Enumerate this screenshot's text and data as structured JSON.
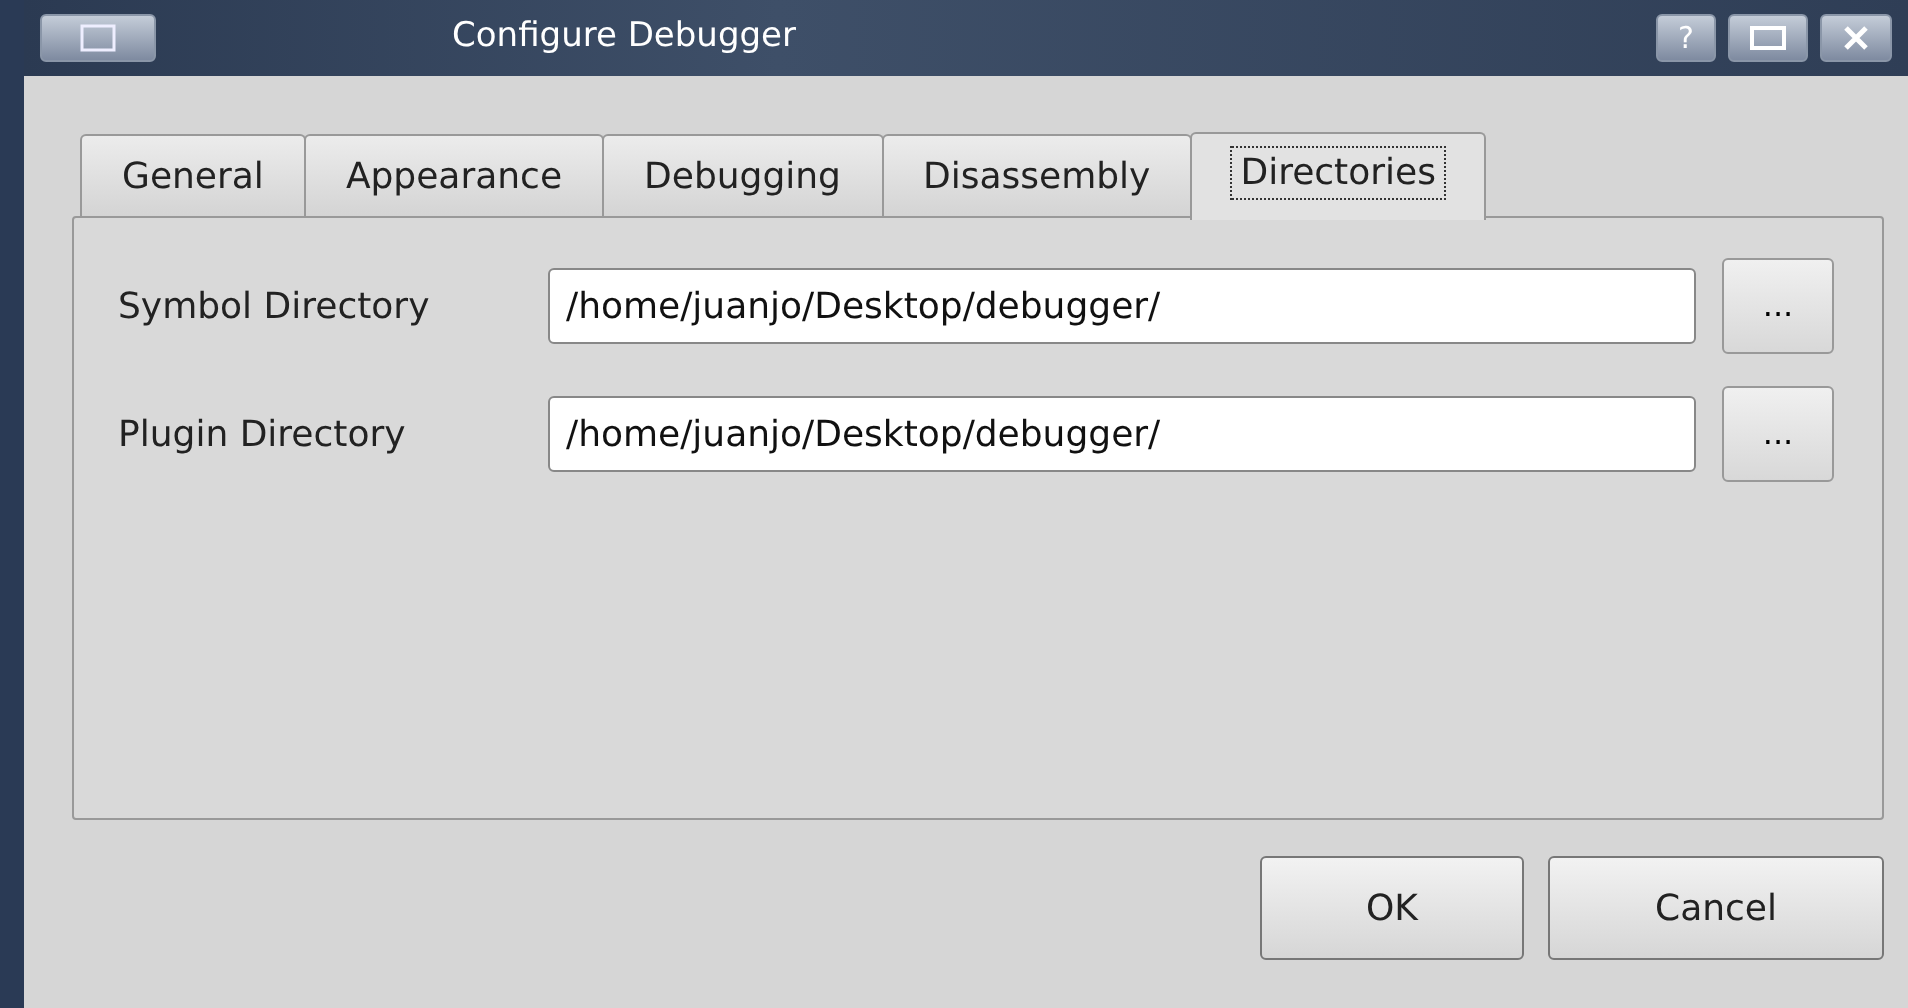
{
  "window": {
    "title": "Configure Debugger",
    "help": "?"
  },
  "tabs": [
    {
      "label": "General",
      "selected": false
    },
    {
      "label": "Appearance",
      "selected": false
    },
    {
      "label": "Debugging",
      "selected": false
    },
    {
      "label": "Disassembly",
      "selected": false
    },
    {
      "label": "Directories",
      "selected": true
    }
  ],
  "fields": [
    {
      "label": "Symbol Directory",
      "value": "/home/juanjo/Desktop/debugger/",
      "browse": "..."
    },
    {
      "label": "Plugin Directory",
      "value": "/home/juanjo/Desktop/debugger/",
      "browse": "..."
    }
  ],
  "buttons": [
    "OK",
    "Cancel"
  ]
}
